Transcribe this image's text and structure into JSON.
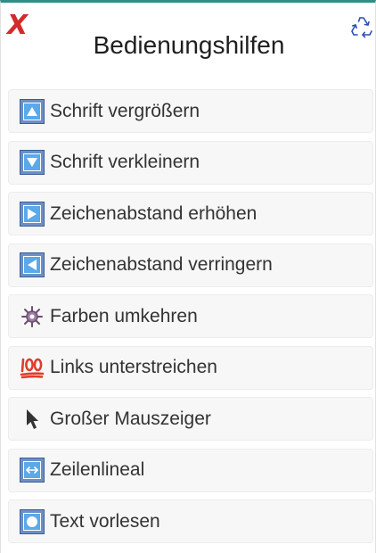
{
  "header": {
    "close_icon": "close-x-icon",
    "reset_icon": "recycle-reset-icon",
    "title": "Bedienungshilfen"
  },
  "colors": {
    "close": "#d42a2a",
    "reset_icon": "#2c4fb5",
    "icon_blue": "#5aa9ea",
    "item_bg": "#f7f7f7",
    "top_border": "#2f8f86"
  },
  "menu": {
    "items": [
      {
        "label": "Schrift vergrößern",
        "icon": "up-triangle-icon"
      },
      {
        "label": "Schrift verkleinern",
        "icon": "down-triangle-icon"
      },
      {
        "label": "Zeichenabstand erhöhen",
        "icon": "right-triangle-icon"
      },
      {
        "label": "Zeichenabstand verringern",
        "icon": "left-triangle-icon"
      },
      {
        "label": "Farben umkehren",
        "icon": "invert-colors-icon"
      },
      {
        "label": "Links unterstreichen",
        "icon": "hundred-points-icon"
      },
      {
        "label": "Großer Mauszeiger",
        "icon": "cursor-icon"
      },
      {
        "label": "Zeilenlineal",
        "icon": "left-right-arrow-icon"
      },
      {
        "label": "Text vorlesen",
        "icon": "speak-circle-icon"
      }
    ]
  }
}
